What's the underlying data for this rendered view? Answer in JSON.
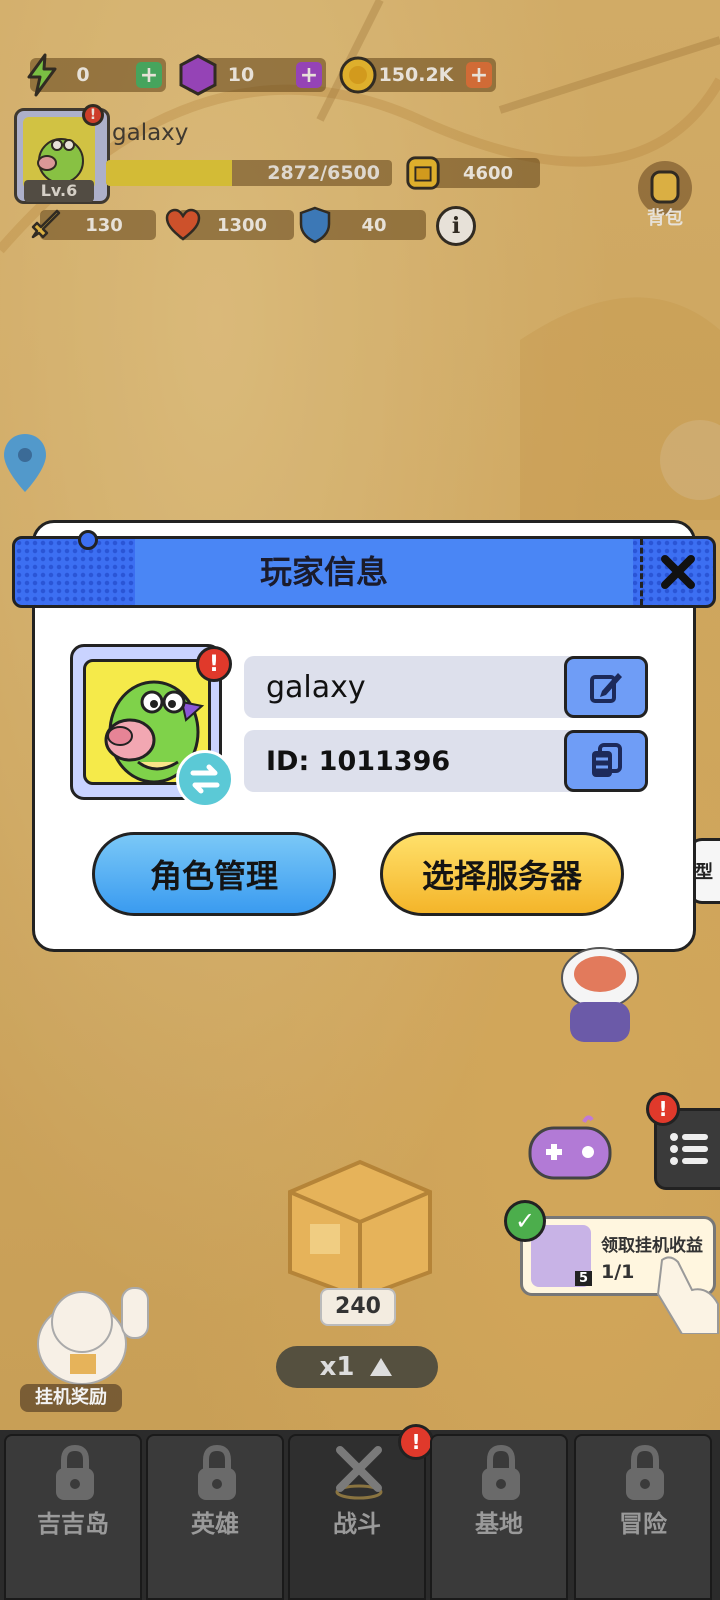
{
  "hud": {
    "energy": {
      "value": "0",
      "icon": "lightning-icon"
    },
    "gems": {
      "value": "10",
      "icon": "gem-icon"
    },
    "coins": {
      "value": "150.2K",
      "icon": "coin-icon"
    },
    "player_name": "galaxy",
    "level": "Lv.6",
    "exp_text": "2872/6500",
    "exp_fraction": 0.442,
    "power": "4600",
    "attack": "130",
    "hp": "1300",
    "defense": "40",
    "backpack_label": "背包"
  },
  "dialog": {
    "title": "玩家信息",
    "name": "galaxy",
    "id_text": "ID: 1011396",
    "role_button": "角色管理",
    "server_button": "选择服务器"
  },
  "side": {
    "partial_label": "型",
    "idle_reward_title": "领取挂机收益",
    "idle_reward_count": "1/1",
    "idle_box_count": "5",
    "chest_count": "240",
    "speed": "x1",
    "afk_label": "挂机奖励"
  },
  "nav": {
    "tabs": [
      "吉吉岛",
      "英雄",
      "战斗",
      "基地",
      "冒险"
    ]
  },
  "colors": {
    "header_blue": "#3c6ff2",
    "role_button": "#4aa8f0",
    "server_button": "#f5c22e",
    "badge_red": "#e0392b"
  }
}
